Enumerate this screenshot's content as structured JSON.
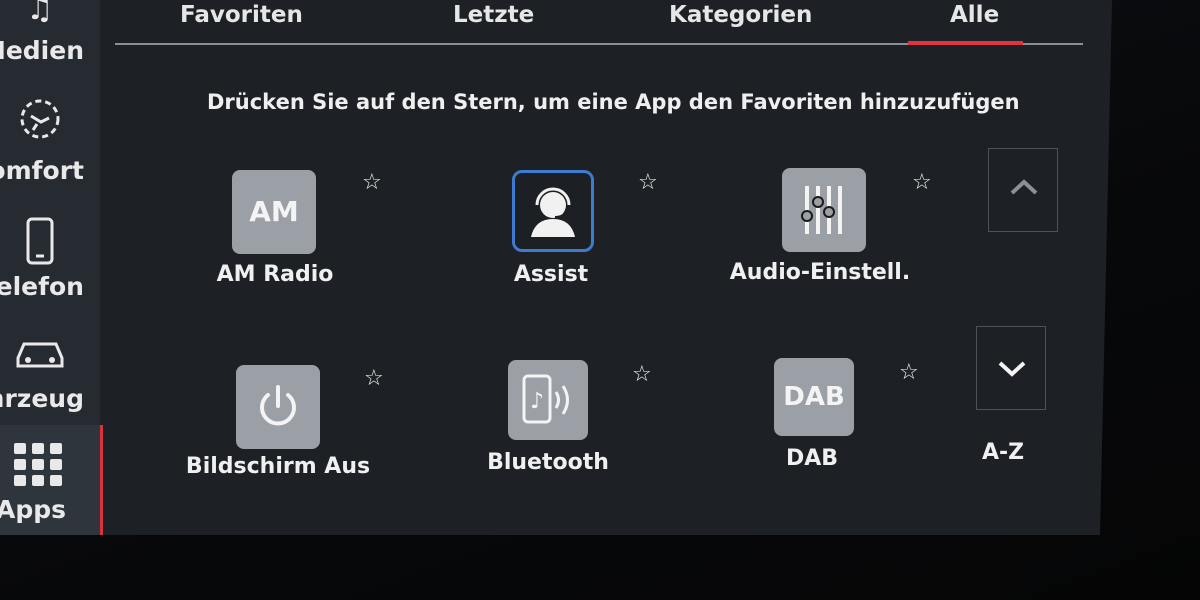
{
  "sidebar": {
    "items": [
      {
        "label": "Medien",
        "icon": "music-note-icon"
      },
      {
        "label": "Komfort",
        "icon": "seat-icon"
      },
      {
        "label": "Telefon",
        "icon": "phone-icon"
      },
      {
        "label": "Fahrzeug",
        "icon": "car-icon"
      },
      {
        "label": "Apps",
        "icon": "app-grid-icon",
        "active": true
      }
    ]
  },
  "tabs": [
    {
      "label": "Favoriten"
    },
    {
      "label": "Letzte"
    },
    {
      "label": "Kategorien"
    },
    {
      "label": "Alle",
      "active": true
    }
  ],
  "hint": "Drücken Sie auf den Stern, um eine App den Favoriten hinzuzufügen",
  "apps": [
    {
      "label": "AM Radio",
      "tile_text": "AM",
      "icon": "am-radio-icon"
    },
    {
      "label": "Assist",
      "icon": "assist-headset-icon"
    },
    {
      "label": "Audio-Einstell.",
      "icon": "equalizer-icon"
    },
    {
      "label": "Bildschirm Aus",
      "icon": "power-icon"
    },
    {
      "label": "Bluetooth",
      "icon": "bluetooth-audio-icon"
    },
    {
      "label": "DAB",
      "tile_text": "DAB",
      "icon": "dab-icon"
    }
  ],
  "sort": {
    "label": "A-Z"
  },
  "colors": {
    "accent": "#e0323f",
    "assist_border": "#3d7bd3",
    "tile": "#9aa0a6"
  }
}
